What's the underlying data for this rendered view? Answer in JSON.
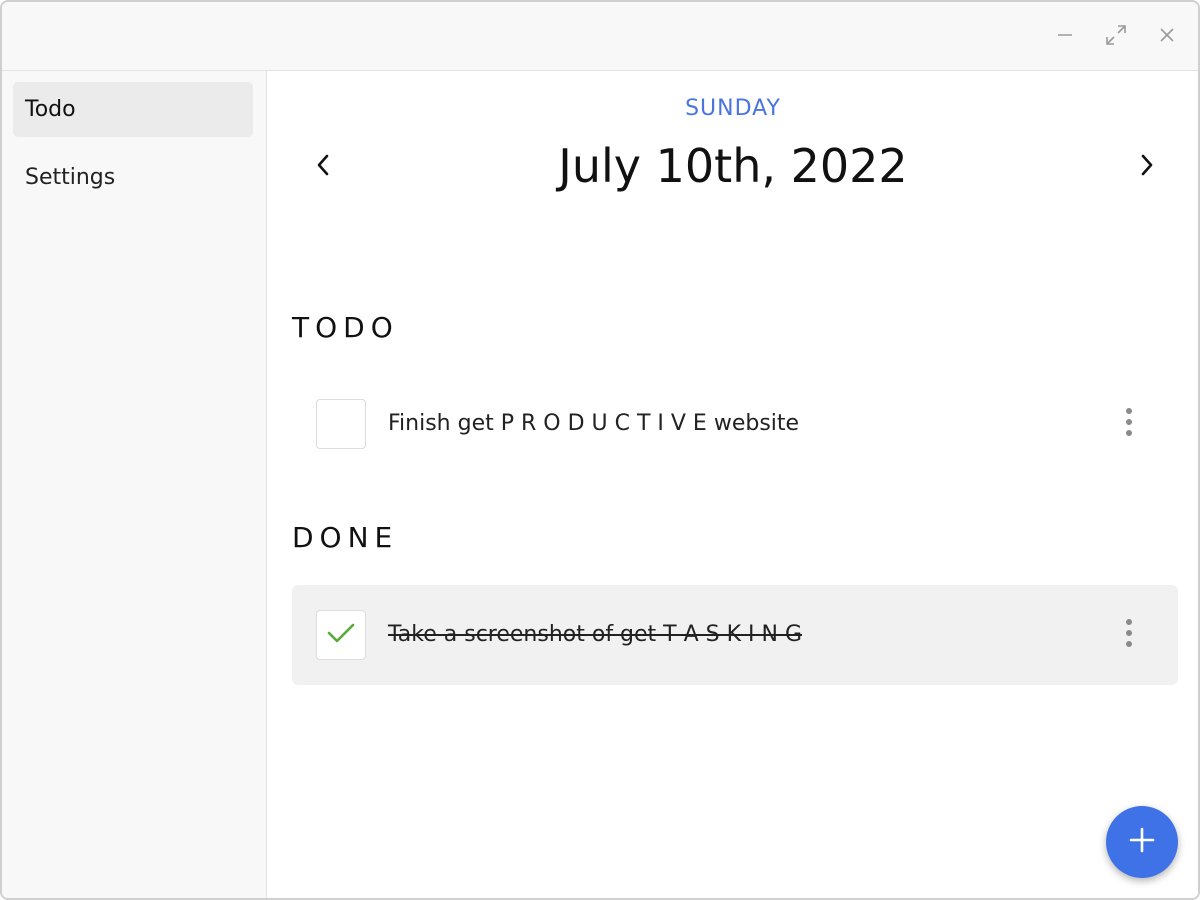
{
  "window": {
    "controls": [
      {
        "name": "minimize",
        "icon": "minimize-icon"
      },
      {
        "name": "maximize",
        "icon": "expand-icon"
      },
      {
        "name": "close",
        "icon": "close-icon"
      }
    ]
  },
  "sidebar": {
    "items": [
      {
        "label": "Todo",
        "active": true
      },
      {
        "label": "Settings",
        "active": false
      }
    ]
  },
  "header": {
    "weekday": "SUNDAY",
    "date": "July 10th, 2022",
    "prev_icon": "chevron-left-icon",
    "next_icon": "chevron-right-icon"
  },
  "sections": {
    "todo": {
      "title": "TODO",
      "tasks": [
        {
          "text": "Finish get P R O D U C T I V E website",
          "checked": false
        }
      ]
    },
    "done": {
      "title": "DONE",
      "tasks": [
        {
          "text": "Take a screenshot of get T A S K I N G",
          "checked": true
        }
      ]
    }
  },
  "fab": {
    "icon": "plus-icon"
  },
  "colors": {
    "accent": "#3f72e6",
    "weekday": "#4a74e0",
    "check": "#5aaa3c",
    "done_row_bg": "#f1f1f1"
  }
}
